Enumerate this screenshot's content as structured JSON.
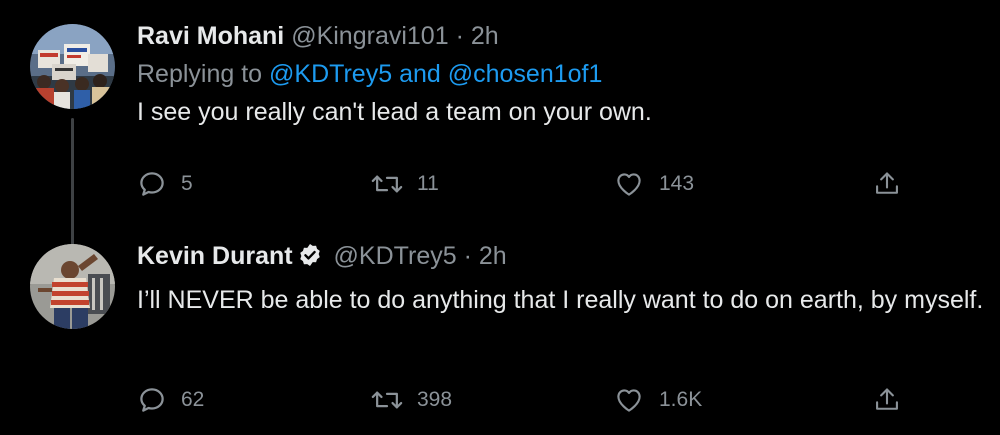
{
  "tweets": [
    {
      "name": "Ravi Mohani",
      "handle": "@Kingravi101",
      "separator": "·",
      "time": "2h",
      "replying_prefix": "Replying to",
      "replying_to_1": "@KDTrey5",
      "replying_and": "and",
      "replying_to_2": "@chosen1of1",
      "text": "I see you really can't lead a team on your own.",
      "replies": "5",
      "retweets": "11",
      "likes": "143",
      "avatar_icon": "protest-crowd-avatar",
      "verified": false
    },
    {
      "name": "Kevin Durant",
      "handle": "@KDTrey5",
      "separator": "·",
      "time": "2h",
      "text": "I’ll NEVER be able to do anything that I really want to do on earth, by myself.",
      "replies": "62",
      "retweets": "398",
      "likes": "1.6K",
      "avatar_icon": "striped-shirt-person-avatar",
      "verified": true
    }
  ],
  "icons": {
    "reply": "reply-icon",
    "retweet": "retweet-icon",
    "like": "heart-icon",
    "share": "share-icon",
    "verified": "verified-badge-icon"
  },
  "colors": {
    "background": "#000000",
    "text": "#e7e9ea",
    "secondary": "#8b9298",
    "link": "#1d9bf0",
    "thread_line": "#3e4144"
  }
}
